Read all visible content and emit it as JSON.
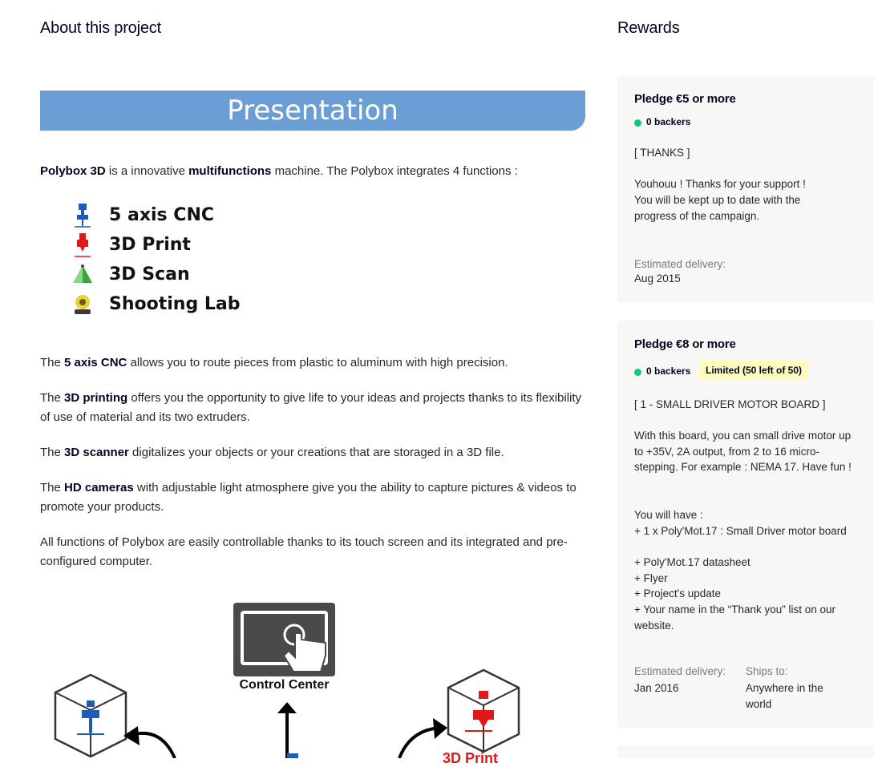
{
  "about": {
    "heading": "About this project",
    "banner": "Presentation",
    "intro": {
      "b1": "Polybox 3D",
      "t1": " is a innovative ",
      "b2": "multifunctions",
      "t2": " machine. The Polybox integrates 4 functions :"
    },
    "functions": [
      {
        "label": "5 axis CNC",
        "icon": "cnc-spindle-icon"
      },
      {
        "label": "3D Print",
        "icon": "3d-print-nozzle-icon"
      },
      {
        "label": "3D Scan",
        "icon": "3d-scan-cone-icon"
      },
      {
        "label": "Shooting Lab",
        "icon": "camera-icon"
      }
    ],
    "paragraphs": [
      {
        "pre": "The ",
        "bold": "5 axis CNC",
        "post": " allows you to route pieces from plastic to aluminum with high precision."
      },
      {
        "pre": "The ",
        "bold": "3D printing",
        "post": " offers you the opportunity to give life to your ideas and projects thanks to its flexibility of use of material and its two extruders."
      },
      {
        "pre": "The ",
        "bold": "3D scanner",
        "post": " digitalizes your objects or your creations that are storaged in a 3D file."
      },
      {
        "pre": "The ",
        "bold": "HD cameras",
        "post": " with adjustable light atmosphere give you the ability to capture pictures & videos to promote your products."
      },
      {
        "pre": "",
        "bold": "",
        "post": "All functions of Polybox are easily controllable thanks to its touch screen and its integrated and pre-configured computer."
      }
    ],
    "diagram": {
      "control_center": "Control Center",
      "print_label_partial": "3D Print"
    }
  },
  "rewards": {
    "heading": "Rewards",
    "cards": [
      {
        "pledge": "Pledge €5 or more",
        "backers": "0 backers",
        "title": "[ THANKS ]",
        "body": [
          "Youhouu ! Thanks for your support !",
          "You will be kept up to date with the progress of the campaign."
        ],
        "delivery_label": "Estimated delivery:",
        "delivery": "Aug 2015"
      },
      {
        "pledge": "Pledge €8 or more",
        "backers": "0 backers",
        "limited": "Limited (50 left of 50)",
        "title": "[ 1 - SMALL DRIVER MOTOR BOARD ]",
        "body": "With this board, you can small drive motor up to +35V, 2A output, from 2 to 16 micro-stepping. For example : NEMA 17. Have fun !",
        "have_label": "You will have :",
        "items": [
          "+ 1 x Poly'Mot.17 : Small Driver motor board",
          "+ Poly'Mot.17 datasheet",
          "+ Flyer",
          "+ Project's update",
          "+ Your name in the “Thank you” list on our website."
        ],
        "delivery_label": "Estimated delivery:",
        "delivery": "Jan 2016",
        "ships_label": "Ships to:",
        "ships": "Anywhere in the world"
      }
    ]
  },
  "colors": {
    "banner": "#6c9ed6",
    "backer_dot": "#05ce78",
    "limited_bg": "#fffbbf",
    "card_bg": "#f7f7f6"
  }
}
